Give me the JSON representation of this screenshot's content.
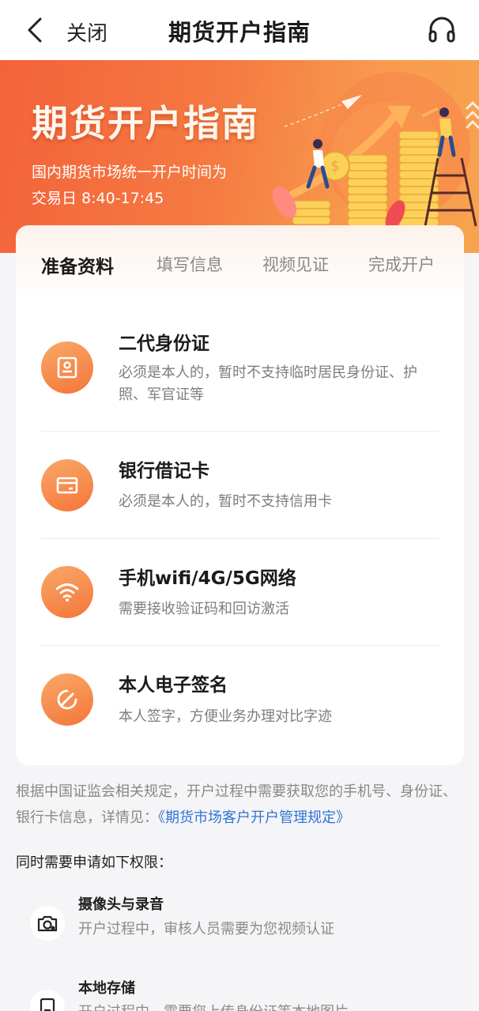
{
  "nav": {
    "back_icon": "chevron-left-icon",
    "close_label": "关闭",
    "title": "期货开户指南",
    "service_icon": "headset-icon"
  },
  "banner": {
    "title": "期货开户指南",
    "subtitle_line1": "国内期货市场统一开户时间为",
    "subtitle_line2": "交易日 8:40-17:45"
  },
  "steps": [
    {
      "label": "准备资料",
      "active": true
    },
    {
      "label": "填写信息",
      "active": false
    },
    {
      "label": "视频见证",
      "active": false
    },
    {
      "label": "完成开户",
      "active": false
    }
  ],
  "requirements": [
    {
      "icon": "id-card-icon",
      "title": "二代身份证",
      "desc": "必须是本人的，暂时不支持临时居民身份证、护照、军官证等"
    },
    {
      "icon": "bank-card-icon",
      "title": "银行借记卡",
      "desc": "必须是本人的，暂时不支持信用卡"
    },
    {
      "icon": "wifi-icon",
      "title": "手机wifi/4G/5G网络",
      "desc": "需要接收验证码和回访激活"
    },
    {
      "icon": "signature-icon",
      "title": "本人电子签名",
      "desc": "本人签字，方便业务办理对比字迹"
    }
  ],
  "notice": {
    "text": "根据中国证监会相关规定，开户过程中需要获取您的手机号、身份证、银行卡信息，详情见：",
    "link": "《期货市场客户开户管理规定》"
  },
  "permissions": {
    "heading": "同时需要申请如下权限：",
    "items": [
      {
        "icon": "camera-icon",
        "title": "摄像头与录音",
        "desc": "开户过程中，审核人员需要为您视频认证"
      },
      {
        "icon": "storage-icon",
        "title": "本地存储",
        "desc": "开户过程中，需要您上传身份证等本地图片"
      }
    ]
  },
  "colors": {
    "accent": "#f4763a",
    "banner_start": "#f4623a",
    "banner_end": "#f7a34f",
    "link": "#2f74d6"
  }
}
